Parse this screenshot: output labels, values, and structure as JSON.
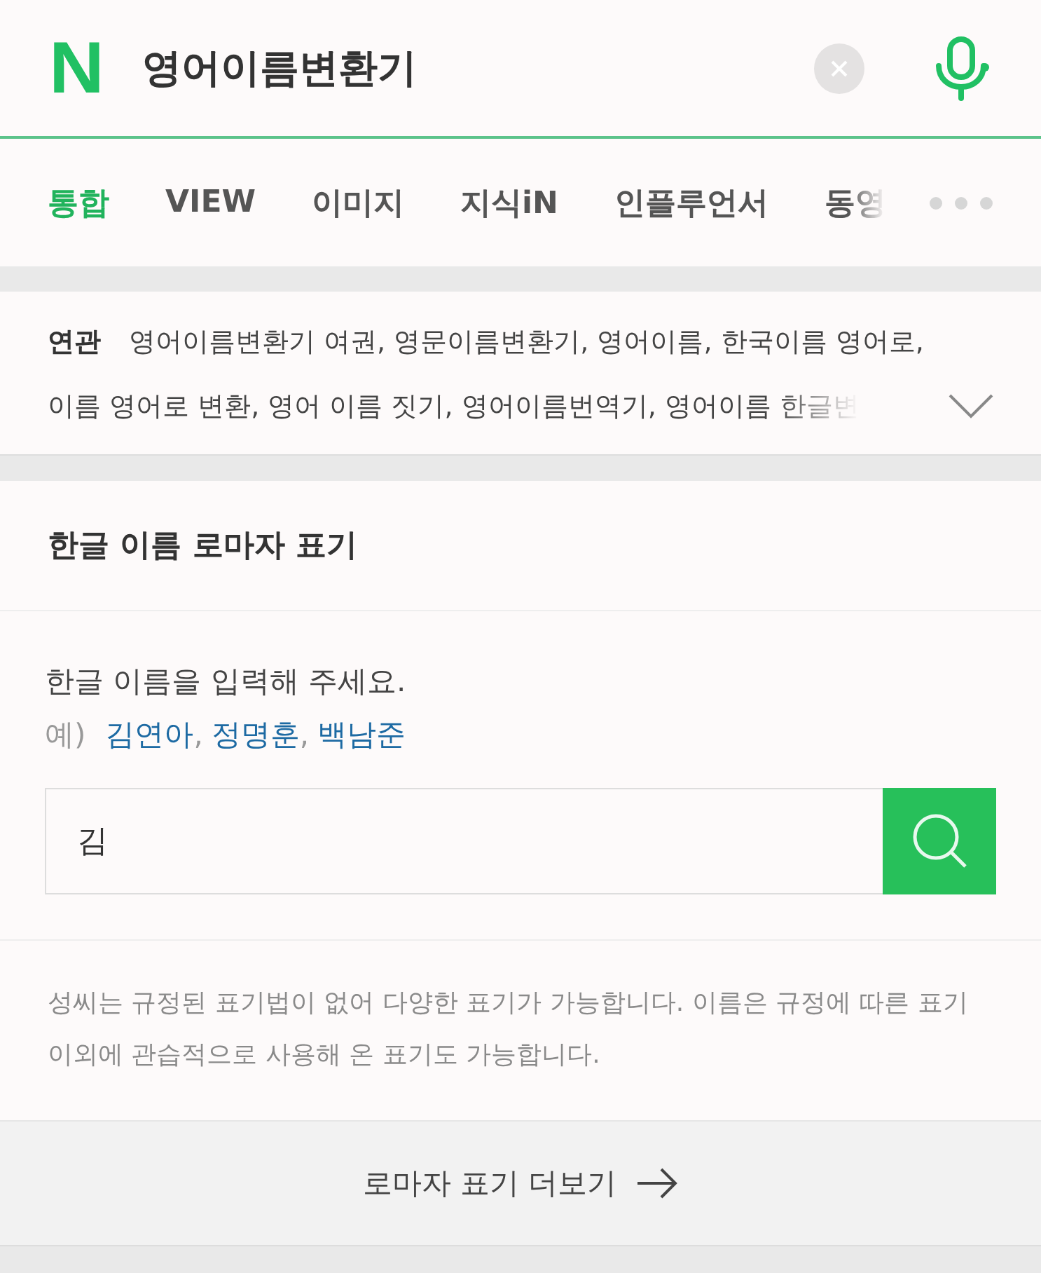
{
  "search": {
    "logo": "N",
    "query": "영어이름변환기"
  },
  "tabs": [
    {
      "label": "통합",
      "selected": true
    },
    {
      "label": "VIEW",
      "selected": false
    },
    {
      "label": "이미지",
      "selected": false
    },
    {
      "label": "지식iN",
      "selected": false
    },
    {
      "label": "인플루언서",
      "selected": false
    },
    {
      "label": "동영",
      "selected": false
    }
  ],
  "related": {
    "label": "연관",
    "lines": [
      "영어이름변환기 여권, 영문이름변환기, 영어이름, 한국이름 영어로,",
      "이름 영어로 변환, 영어 이름 짓기, 영어이름번역기, 영어이름 한글변"
    ]
  },
  "converter": {
    "title": "한글 이름 로마자 표기",
    "prompt": "한글 이름을 입력해 주세요.",
    "example_label": "예)",
    "separator": ",",
    "examples": [
      "김연아",
      "정명훈",
      "백남준"
    ],
    "value": "김",
    "note": "성씨는 규정된 표기법이 없어 다양한 표기가 가능합니다. 이름은 규정에 따른 표기 이외에 관습적으로 사용해 온 표기도 가능합니다.",
    "more": "로마자 표기 더보기"
  }
}
